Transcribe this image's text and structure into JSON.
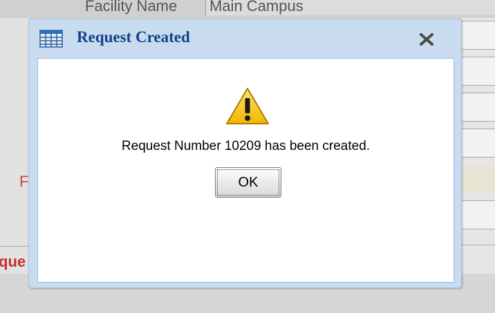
{
  "background": {
    "facility_label": "Facility Name",
    "facility_value": "Main Campus",
    "partial_red_label_1": "F",
    "partial_red_label_2": "que"
  },
  "dialog": {
    "title": "Request Created",
    "title_icon": "grid-table-icon",
    "close_icon": "close-icon",
    "warning_icon": "warning-icon",
    "message": "Request Number 10209 has been created.",
    "ok_label": "OK"
  },
  "colors": {
    "title_text": "#15428b",
    "dialog_frame": "#c9dbef",
    "dialog_border": "#99bbe8",
    "warning_yellow": "#f5c400",
    "background_red_text": "#d04040"
  }
}
